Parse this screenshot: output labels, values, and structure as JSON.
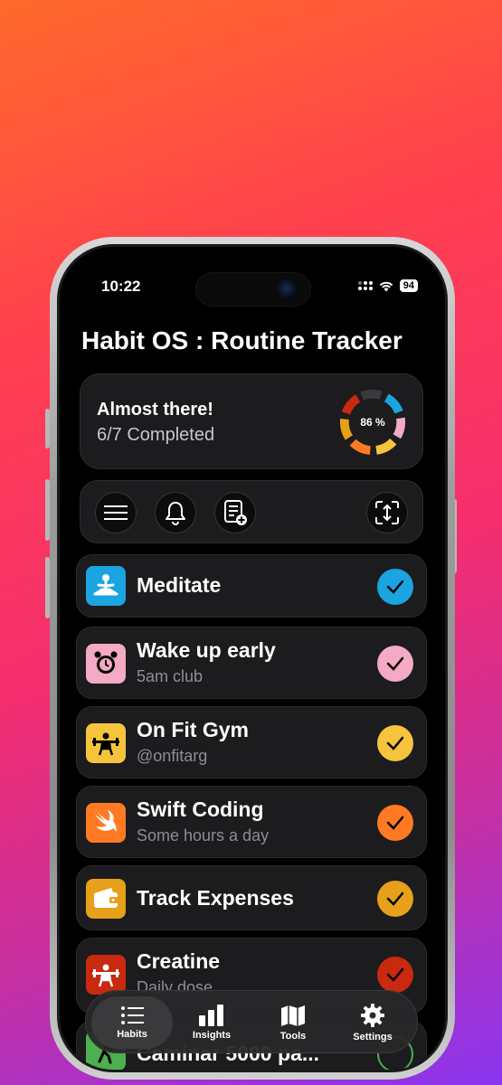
{
  "status": {
    "time": "10:22",
    "battery": "94"
  },
  "app": {
    "title": "Habit OS : Routine Tracker"
  },
  "progress": {
    "headline": "Almost there!",
    "completed_text": "6/7 Completed",
    "percent_label": "86 %",
    "percent": 86
  },
  "toolbar": {
    "menu_icon": "hamburger-menu-icon",
    "bell_icon": "bell-icon",
    "add_list_icon": "add-list-icon",
    "expand_icon": "expand-arrows-icon"
  },
  "habits": [
    {
      "name": "Meditate",
      "subtitle": "",
      "icon": "meditation-icon",
      "color": "#1aa4e0",
      "checked": true
    },
    {
      "name": "Wake up early",
      "subtitle": "5am club",
      "icon": "alarm-clock-icon",
      "color": "#f4a9c4",
      "checked": true
    },
    {
      "name": "On Fit Gym",
      "subtitle": "@onfitarg",
      "icon": "weightlifter-icon",
      "color": "#f6c43c",
      "checked": true
    },
    {
      "name": "Swift Coding",
      "subtitle": "Some hours a day",
      "icon": "swift-logo-icon",
      "color": "#ff7a22",
      "checked": true
    },
    {
      "name": "Track Expenses",
      "subtitle": "",
      "icon": "wallet-icon",
      "color": "#e6a019",
      "checked": true
    },
    {
      "name": "Creatine",
      "subtitle": "Daily dose",
      "icon": "weightlifter-icon",
      "color": "#c8290f",
      "checked": true
    },
    {
      "name": "Caminar 5000 pa...",
      "subtitle": "",
      "icon": "walking-icon",
      "color": "#4caf50",
      "checked": false
    }
  ],
  "tabs": [
    {
      "label": "Habits",
      "icon": "list-icon",
      "active": true
    },
    {
      "label": "Insights",
      "icon": "bar-chart-icon",
      "active": false
    },
    {
      "label": "Tools",
      "icon": "map-icon",
      "active": false
    },
    {
      "label": "Settings",
      "icon": "gear-icon",
      "active": false
    }
  ]
}
